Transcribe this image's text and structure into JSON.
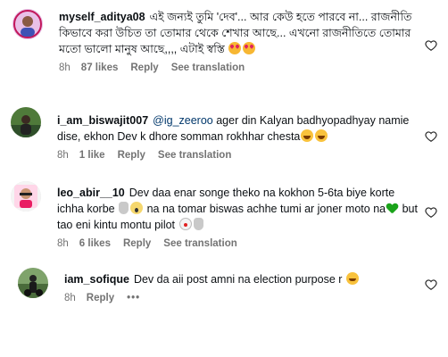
{
  "comments": [
    {
      "username": "myself_aditya08",
      "text": "এই জন্যই তুমি 'দেব'... আর কেউ হতে পারবে না... রাজনীতি কিভাবে করা উচিত তা তোমার থেকে শেখার আছে... এখনো রাজনীতিতে তোমার মতো ভালো মানুষ আছে,,,, এটাই স্বস্তি",
      "emojis": [
        "love-eyes-emoji",
        "love-eyes-emoji"
      ],
      "time": "8h",
      "likes": "87 likes",
      "reply": "Reply",
      "translation": "See translation"
    },
    {
      "username": "i_am_biswajit007",
      "mention": "@ig_zeeroo",
      "text": "ager din Kalyan badhyopadhyay namie dise, ekhon Dev k dhore somman rokhhar chesta",
      "emojis": [
        "laughing-emoji",
        "laughing-emoji"
      ],
      "time": "8h",
      "likes": "1 like",
      "reply": "Reply",
      "translation": "See translation"
    },
    {
      "username": "leo_abir__10",
      "text_part1": "Dev daa enar songe theko na kokhon 5-6ta biye korte ichha korbe",
      "text_part2": "na na tomar biswas achhe tumi ar joner moto na",
      "text_part3": "but tao eni kintu montu pilot",
      "time": "8h",
      "likes": "6 likes",
      "reply": "Reply",
      "translation": "See translation"
    },
    {
      "username": "iam_sofique",
      "text": "Dev da aii post amni na election purpose r",
      "time": "8h",
      "reply": "Reply",
      "more": "•••"
    }
  ]
}
